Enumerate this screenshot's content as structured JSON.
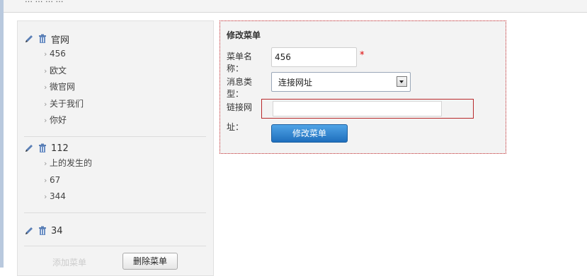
{
  "top_bar": {
    "text": "…  …  …  …"
  },
  "menu": {
    "groups": [
      {
        "name": "官网",
        "items": [
          "456",
          "欧文",
          "微官网",
          "关于我们",
          "你好"
        ]
      },
      {
        "name": "112",
        "items": [
          "上的发生的",
          "67",
          "344"
        ]
      },
      {
        "name": "34",
        "items": []
      }
    ],
    "add_menu_label": "添加菜单",
    "delete_menu_label": "删除菜单",
    "icons": [
      "pencil-icon",
      "trash-icon"
    ]
  },
  "form": {
    "title": "修改菜单",
    "name_label_1": "菜单名",
    "name_label_2": "称：",
    "name_value": "456",
    "required_mark": "*",
    "type_label_1": "消息类",
    "type_label_2": "型：",
    "type_value": "连接网址",
    "url_label_1": "链接网",
    "url_label_2": "址：",
    "url_value": "",
    "submit_label": "修改菜单"
  },
  "colors": {
    "accent": "#1f6fbd",
    "error_border": "#b8282a",
    "required": "#dd0000"
  }
}
